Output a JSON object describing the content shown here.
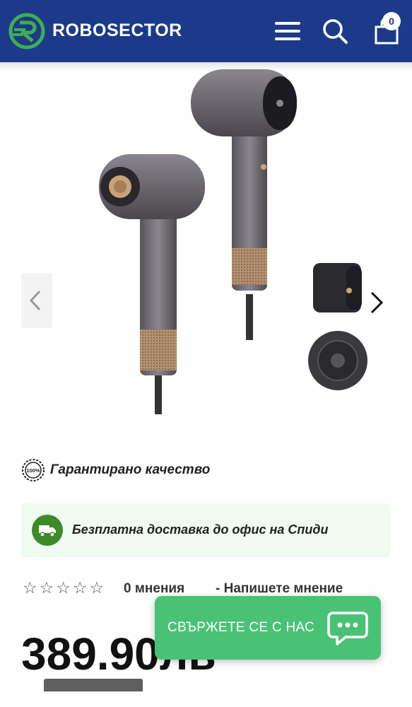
{
  "header": {
    "brand": "ROBOSECTOR",
    "brand_color": "#1d3a8a",
    "logo_color": "#3fae52",
    "cart_count": "0",
    "icons": [
      "logo-icon",
      "hamburger-menu-icon",
      "search-icon",
      "cart-icon"
    ]
  },
  "gallery": {
    "product_image": "hair dryers",
    "prev_icon": "chevron-left-icon",
    "next_icon": "chevron-right-icon"
  },
  "features": {
    "quality_badge": "100%",
    "quality": "Гарантирано качество",
    "delivery": "Безплатна доставка до офис на Спиди",
    "delivery_icon": "truck-icon",
    "delivery_icon_color": "#3d8a2b"
  },
  "rating": {
    "stars": "☆☆☆☆☆",
    "reviews": "0 мнения",
    "write_review": "- Напишете мнение"
  },
  "price": {
    "value": "389.90лв"
  },
  "contact": {
    "label": "СВЪРЖЕТЕ СЕ С НАС",
    "color": "#49c275",
    "icon": "chat-bubble-icon"
  }
}
